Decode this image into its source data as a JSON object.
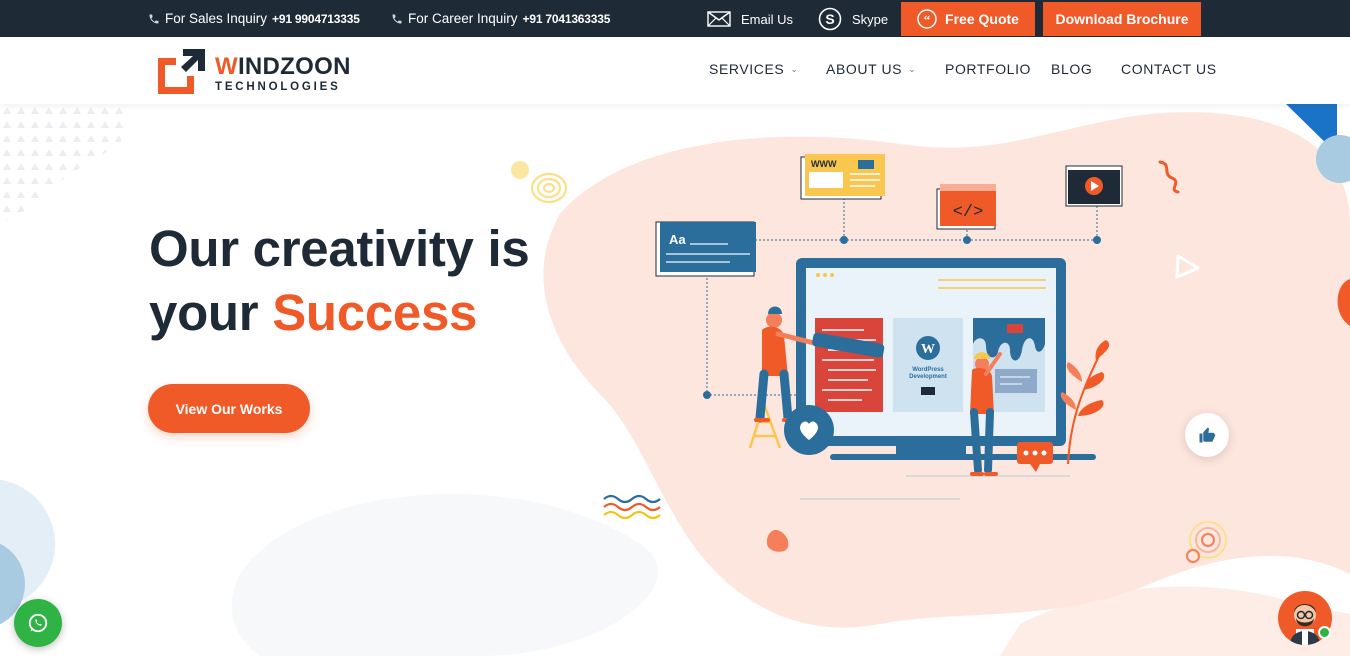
{
  "topbar": {
    "sales_label": "For Sales Inquiry",
    "sales_phone": "+91 9904713335",
    "career_label": "For Career Inquiry",
    "career_phone": "+91 7041363335",
    "email_label": "Email Us",
    "skype_label": "Skype",
    "quote_label": "Free Quote",
    "brochure_label": "Download Brochure"
  },
  "header": {
    "logo_word_first": "W",
    "logo_word_rest": "INDZOON",
    "logo_sub": "TECHNOLOGIES",
    "nav": [
      {
        "label": "SERVICES",
        "has_dropdown": true
      },
      {
        "label": "ABOUT US",
        "has_dropdown": true
      },
      {
        "label": "PORTFOLIO",
        "has_dropdown": false
      },
      {
        "label": "BLOG",
        "has_dropdown": false
      },
      {
        "label": "CONTACT US",
        "has_dropdown": false
      }
    ]
  },
  "hero": {
    "line1": "Our creativity is",
    "line2_prefix": "your ",
    "line2_accent": "Success",
    "cta_label": "View Our Works"
  },
  "illustration": {
    "aa_card": "Aa",
    "www_card": "WWW",
    "code_card": "</>",
    "wp_line1": "WordPress",
    "wp_line2": "Development"
  },
  "icons": {
    "whatsapp": "whatsapp-icon",
    "chatbot": "chat-avatar-icon",
    "thumbs": "thumbs-up-icon"
  },
  "colors": {
    "accent": "#f05a28",
    "dark": "#1e2a36",
    "blob": "#fde6dd",
    "blue": "#2b6e9c",
    "green": "#2fb344"
  }
}
